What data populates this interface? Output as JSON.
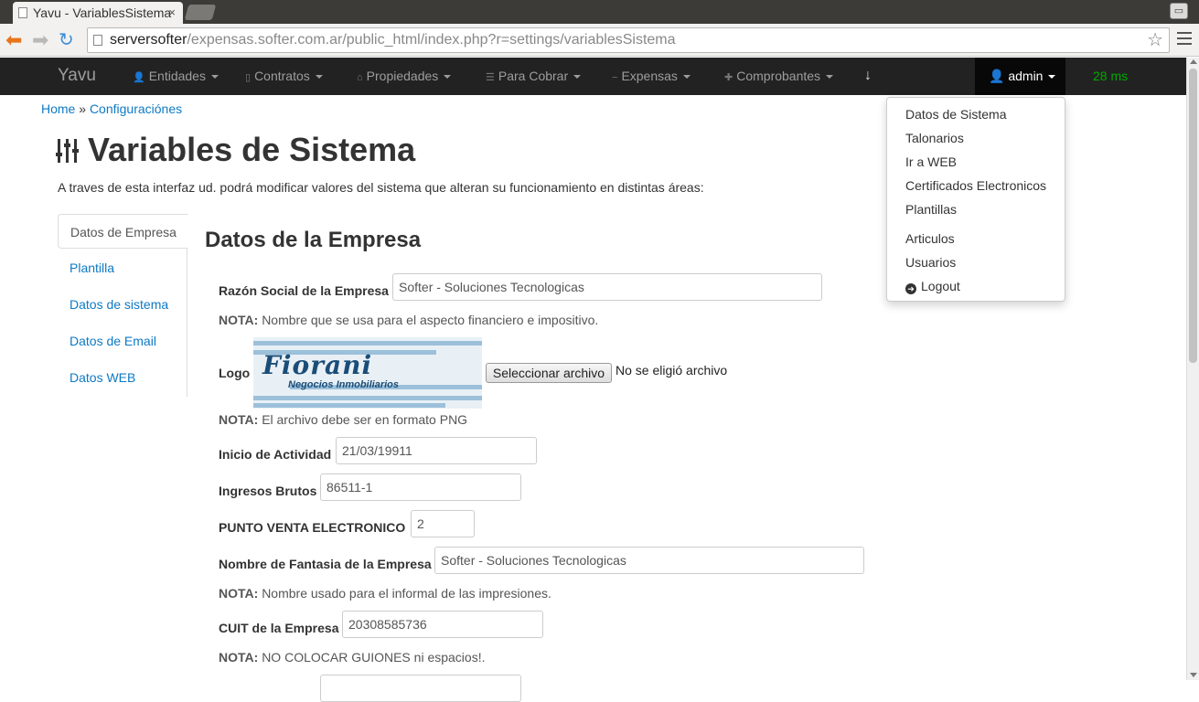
{
  "browser": {
    "tab_title": "Yavu - VariablesSistema",
    "tab_close": "×",
    "url_host": "serversofter",
    "url_path": "/expensas.softer.com.ar/public_html/index.php?r=settings/variablesSistema",
    "back_icon": "back-arrow-icon",
    "forward_icon": "forward-arrow-icon",
    "reload_icon": "reload-icon",
    "star_icon": "bookmark-star-icon"
  },
  "navbar": {
    "brand": "Yavu",
    "items": [
      {
        "label": "Entidades",
        "icon": "user-icon"
      },
      {
        "label": "Contratos",
        "icon": "file-icon"
      },
      {
        "label": "Propiedades",
        "icon": "home-icon"
      },
      {
        "label": "Para Cobrar",
        "icon": "list-icon"
      },
      {
        "label": "Expensas",
        "icon": "minus-icon"
      },
      {
        "label": "Comprobantes",
        "icon": "plus-icon"
      }
    ],
    "download_icon": "download-arrow-icon",
    "user": "admin",
    "timer": "28 ms"
  },
  "user_menu": {
    "items": [
      "Datos de Sistema",
      "Talonarios",
      "Ir a WEB",
      "Certificados Electronicos",
      "Plantillas",
      "Articulos",
      "Usuarios"
    ],
    "logout": "Logout"
  },
  "breadcrumb": {
    "home": "Home",
    "separator": "»",
    "current": "Configuraciónes"
  },
  "page": {
    "title": "Variables de Sistema",
    "intro": "A traves de esta interfaz ud. podrá modificar valores del sistema que alteran su funcionamiento en distintas áreas:"
  },
  "sidenav": [
    "Datos de Empresa",
    "Plantilla",
    "Datos de sistema",
    "Datos de Email",
    "Datos WEB"
  ],
  "form": {
    "section_title": "Datos de la Empresa",
    "note_prefix": "NOTA:",
    "razon_social": {
      "label": "Razón Social de la Empresa",
      "value": "Softer - Soluciones Tecnologicas",
      "note": "Nombre que se usa para el aspecto financiero e impositivo."
    },
    "logo": {
      "label": "Logo",
      "image_text": "Fiorani",
      "image_subtext": "Negocios Inmobiliarios",
      "button": "Seleccionar archivo",
      "status": "No se eligió archivo",
      "note": "El archivo debe ser en formato PNG"
    },
    "inicio_actividad": {
      "label": "Inicio de Actividad",
      "value": "21/03/19911"
    },
    "ingresos_brutos": {
      "label": "Ingresos Brutos",
      "value": "86511-1"
    },
    "punto_venta": {
      "label": "PUNTO VENTA ELECTRONICO",
      "value": "2"
    },
    "nombre_fantasia": {
      "label": "Nombre de Fantasia de la Empresa",
      "value": "Softer - Soluciones Tecnologicas",
      "note": "Nombre usado para el informal de las impresiones."
    },
    "cuit": {
      "label": "CUIT de la Empresa",
      "value": "20308585736",
      "note": "NO COLOCAR GUIONES ni espacios!."
    }
  }
}
